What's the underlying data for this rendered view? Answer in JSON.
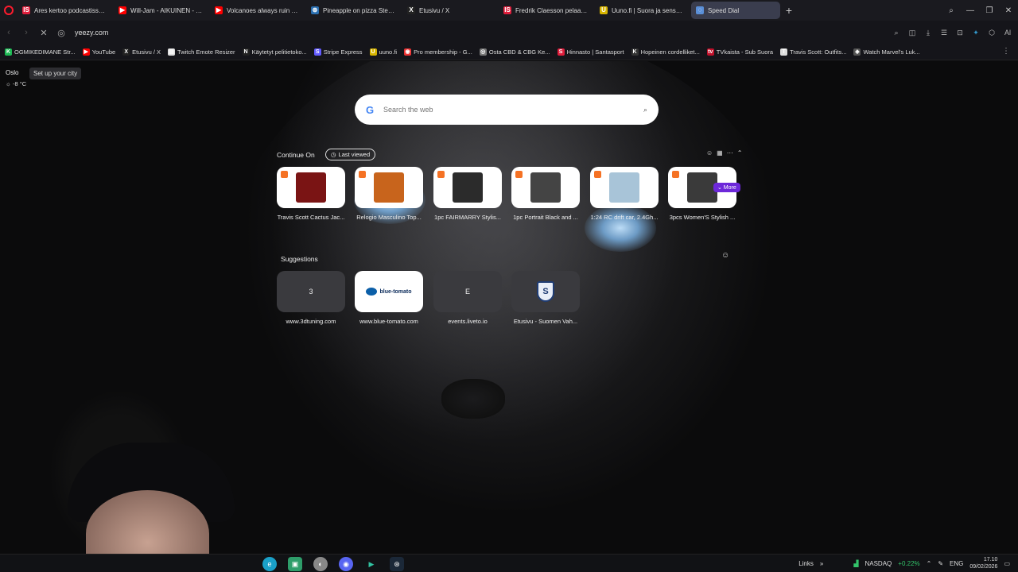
{
  "tabs": [
    {
      "label": "Ares kertoo podcastissa vi",
      "icon": "is-icon",
      "color": "#e01e3c",
      "glyph": "IS"
    },
    {
      "label": "Will-Jam - AIKUINEN - Yo",
      "icon": "youtube-icon",
      "color": "#ff0000",
      "glyph": "▶"
    },
    {
      "label": "Volcanoes always ruin the",
      "icon": "youtube-icon",
      "color": "#ff0000",
      "glyph": "▶"
    },
    {
      "label": "Pineapple on pizza Steam",
      "icon": "steam-icon",
      "color": "#2a6fb0",
      "glyph": "⊛"
    },
    {
      "label": "Etusivu / X",
      "icon": "x-icon",
      "color": "#222222",
      "glyph": "X"
    },
    {
      "label": "Fredrik Claesson pelaa Ver",
      "icon": "is-icon",
      "color": "#e01e3c",
      "glyph": "IS"
    },
    {
      "label": "Uuno.fi | Suora ja sensuroi",
      "icon": "uuno-icon",
      "color": "#d6b400",
      "glyph": "U"
    },
    {
      "label": "Speed Dial",
      "icon": "speed-dial-icon",
      "color": "#5a8fd8",
      "glyph": "◌",
      "active": true
    }
  ],
  "address": {
    "url": "yeezy.com"
  },
  "bookmarks": [
    {
      "label": "OGMIKEDIMANE Str...",
      "color": "#1db954",
      "glyph": "K"
    },
    {
      "label": "YouTube",
      "color": "#ff0000",
      "glyph": "▶"
    },
    {
      "label": "Etusivu / X",
      "color": "#222222",
      "glyph": "X"
    },
    {
      "label": "Twitch Emote Resizer",
      "color": "#dddddd",
      "glyph": "▤"
    },
    {
      "label": "Käytetyt pelitietoko...",
      "color": "#222222",
      "glyph": "N"
    },
    {
      "label": "Stripe Express",
      "color": "#635bff",
      "glyph": "S"
    },
    {
      "label": "uuno.fi",
      "color": "#d6b400",
      "glyph": "U"
    },
    {
      "label": "Pro membership - G...",
      "color": "#e33",
      "glyph": "◉"
    },
    {
      "label": "Osta CBD & CBG Ke...",
      "color": "#777",
      "glyph": "◎"
    },
    {
      "label": "Hinnasto | Santasport",
      "color": "#e01e3c",
      "glyph": "S"
    },
    {
      "label": "Hopeinen cordelliket...",
      "color": "#333",
      "glyph": "K"
    },
    {
      "label": "TVkaista - Sub Suora",
      "color": "#c0102a",
      "glyph": "tv"
    },
    {
      "label": "Travis Scott: Outfits...",
      "color": "#ddd",
      "glyph": "T"
    },
    {
      "label": "Watch Marvel's Luk...",
      "color": "#555",
      "glyph": "◈"
    }
  ],
  "weather": {
    "city": "Oslo",
    "setup": "Set up your city",
    "temp": "-8 °C"
  },
  "search": {
    "placeholder": "Search the web"
  },
  "continue_on": {
    "title": "Continue On",
    "filter": "Last viewed",
    "items": [
      {
        "label": "Travis Scott Cactus Jac...",
        "thumb": "#7a1414"
      },
      {
        "label": "Relogio Masculino Top...",
        "thumb": "#c8641c"
      },
      {
        "label": "1pc FAIRMARRY Stylis...",
        "thumb": "#2b2b2b"
      },
      {
        "label": "1pc Portrait Black and ...",
        "thumb": "#444"
      },
      {
        "label": "1:24 RC drift car, 2.4Gh...",
        "thumb": "#a8c4d8"
      },
      {
        "label": "3pcs Women'S Stylish ...",
        "thumb": "#3a3a3a"
      }
    ],
    "more_label": "⌄ More"
  },
  "suggestions": {
    "title": "Suggestions",
    "items": [
      {
        "label": "www.3dtuning.com",
        "tile": "3"
      },
      {
        "label": "www.blue-tomato.com",
        "tile": "blue-tomato"
      },
      {
        "label": "events.liveto.io",
        "tile": "E"
      },
      {
        "label": "Etusivu - Suomen Vah...",
        "tile": "S"
      }
    ]
  },
  "taskbar": {
    "links": "Links",
    "ticker": "NASDAQ",
    "ticker_change": "+0.22%",
    "lang": "ENG",
    "time": "17.10",
    "date": "09/02/2026"
  }
}
